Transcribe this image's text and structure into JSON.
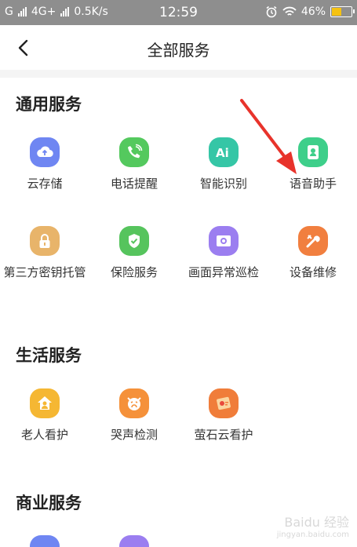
{
  "status_bar": {
    "carrier_left": "G",
    "network": "4G+",
    "speed": "0.5K/s",
    "time": "12:59",
    "battery_percent": "46%"
  },
  "header": {
    "title": "全部服务"
  },
  "sections": [
    {
      "title": "通用服务",
      "items": [
        {
          "label": "云存储",
          "icon": "cloud-upload-icon",
          "color": "#6f86f2"
        },
        {
          "label": "电话提醒",
          "icon": "phone-icon",
          "color": "#54c95e"
        },
        {
          "label": "智能识别",
          "icon": "ai-icon",
          "color": "#35c6a6"
        },
        {
          "label": "语音助手",
          "icon": "voice-assistant-icon",
          "color": "#3ecf8a"
        },
        {
          "label": "第三方密钥托管",
          "icon": "lock-icon",
          "color": "#e8b46a"
        },
        {
          "label": "保险服务",
          "icon": "shield-icon",
          "color": "#56c45d"
        },
        {
          "label": "画面异常巡检",
          "icon": "camera-frame-icon",
          "color": "#9b7ef0"
        },
        {
          "label": "设备维修",
          "icon": "wrench-icon",
          "color": "#f17f3f"
        }
      ]
    },
    {
      "title": "生活服务",
      "items": [
        {
          "label": "老人看护",
          "icon": "elder-care-icon",
          "color": "#f5b733"
        },
        {
          "label": "哭声检测",
          "icon": "crying-face-icon",
          "color": "#f5913a"
        },
        {
          "label": "萤石云看护",
          "icon": "cloud-care-icon",
          "color": "#f07d3a"
        }
      ]
    },
    {
      "title": "商业服务",
      "items": [
        {
          "label": "",
          "icon": "business-icon-1",
          "color": "#6f86f2"
        },
        {
          "label": "",
          "icon": "business-icon-2",
          "color": "#9b7ef0"
        }
      ]
    }
  ],
  "watermark": {
    "text": "Baidu 经验",
    "sub": "jingyan.baidu.com"
  }
}
